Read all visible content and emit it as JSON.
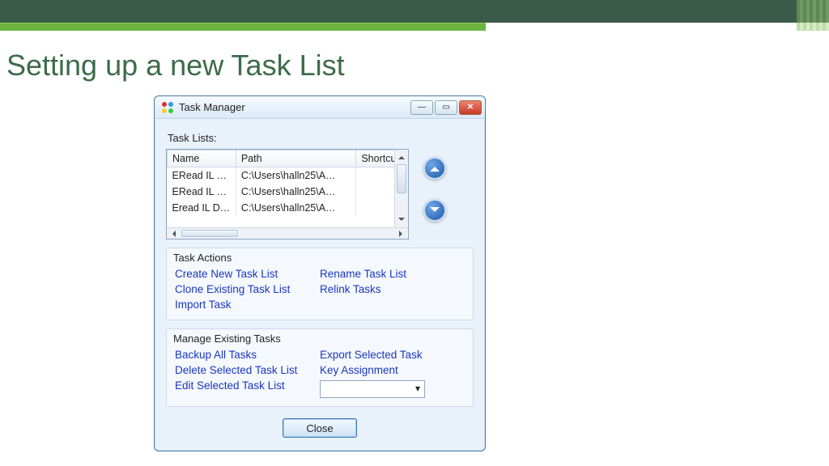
{
  "slide": {
    "title": "Setting up a new Task List"
  },
  "window": {
    "title": "Task Manager",
    "task_lists_label": "Task Lists:",
    "columns": {
      "name": "Name",
      "path": "Path",
      "shortcut": "Shortcut"
    },
    "rows": [
      {
        "name": "ERead IL …",
        "path": "C:\\Users\\halln25\\A…"
      },
      {
        "name": "ERead IL …",
        "path": "C:\\Users\\halln25\\A…"
      },
      {
        "name": "Eread IL D…",
        "path": "C:\\Users\\halln25\\A…"
      }
    ],
    "task_actions": {
      "legend": "Task Actions",
      "create": "Create New Task List",
      "clone": "Clone Existing Task List",
      "import": "Import Task",
      "rename": "Rename Task List",
      "relink": "Relink Tasks"
    },
    "manage": {
      "legend": "Manage Existing Tasks",
      "backup": "Backup All Tasks",
      "delete": "Delete Selected Task List",
      "edit": "Edit Selected Task List",
      "export": "Export Selected Task",
      "key": "Key Assignment"
    },
    "close_label": "Close"
  }
}
